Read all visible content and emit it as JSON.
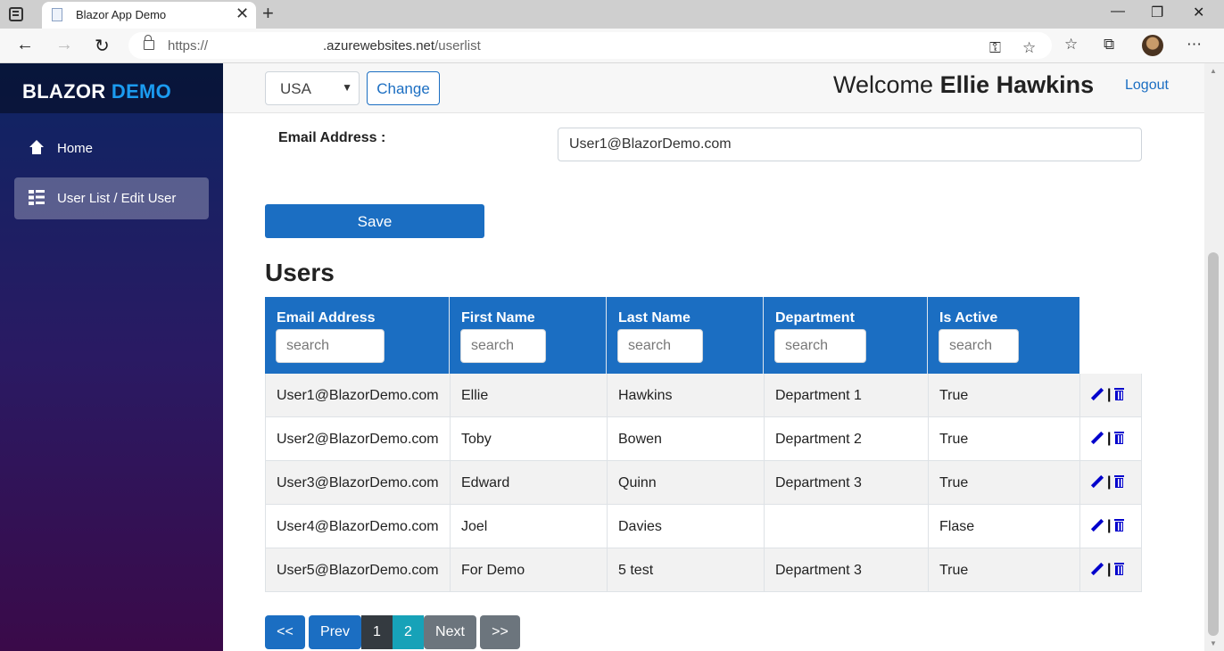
{
  "browser": {
    "tab_title": "Blazor App Demo",
    "tab_close": "✕",
    "new_tab": "+",
    "url_protocol": "https://",
    "url_host": ".azurewebsites.net",
    "url_path": "/userlist",
    "window_controls": {
      "minimize": "—",
      "restore": "❐",
      "close": "✕"
    },
    "nav": {
      "back": "←",
      "forward": "→",
      "reload": "↻"
    },
    "toolbar_icons": {
      "key": "⚿",
      "favorite": "☆",
      "favorites": "☆",
      "collections": "⧉",
      "more": "⋯"
    }
  },
  "sidebar": {
    "brand_part1": "BLAZOR",
    "brand_part2": "DEMO",
    "items": [
      {
        "label": "Home",
        "icon": "home-icon"
      },
      {
        "label": "User List / Edit User",
        "icon": "list-icon",
        "active": true
      }
    ]
  },
  "topbar": {
    "country_value": "USA",
    "change_label": "Change",
    "welcome_prefix": "Welcome",
    "user_name": "Ellie Hawkins",
    "logout_label": "Logout"
  },
  "form": {
    "email_label": "Email Address :",
    "email_value": "User1@BlazorDemo.com",
    "save_label": "Save"
  },
  "users": {
    "title": "Users",
    "columns": [
      {
        "label": "Email Address",
        "placeholder": "search"
      },
      {
        "label": "First Name",
        "placeholder": "search"
      },
      {
        "label": "Last Name",
        "placeholder": "search"
      },
      {
        "label": "Department",
        "placeholder": "search"
      },
      {
        "label": "Is Active",
        "placeholder": "search"
      }
    ],
    "rows": [
      {
        "email": "User1@BlazorDemo.com",
        "first": "Ellie",
        "last": "Hawkins",
        "dept": "Department 1",
        "active": "True"
      },
      {
        "email": "User2@BlazorDemo.com",
        "first": "Toby",
        "last": "Bowen",
        "dept": "Department 2",
        "active": "True"
      },
      {
        "email": "User3@BlazorDemo.com",
        "first": "Edward",
        "last": "Quinn",
        "dept": "Department 3",
        "active": "True"
      },
      {
        "email": "User4@BlazorDemo.com",
        "first": "Joel",
        "last": "Davies",
        "dept": "",
        "active": "Flase"
      },
      {
        "email": "User5@BlazorDemo.com",
        "first": "For Demo",
        "last": "5 test",
        "dept": "Department 3",
        "active": "True"
      }
    ],
    "action_separator": "|"
  },
  "pager": {
    "first": "<<",
    "prev": "Prev",
    "pages": [
      "1",
      "2"
    ],
    "current_page": "1",
    "next": "Next",
    "last": ">>"
  },
  "colors": {
    "primary": "#1b6ec2",
    "brand_accent": "#1b9bf0",
    "action_icons": "#0000cc",
    "page_current": "#343a40",
    "page_other": "#17a2b8",
    "pager_disabled": "#6c757d"
  }
}
